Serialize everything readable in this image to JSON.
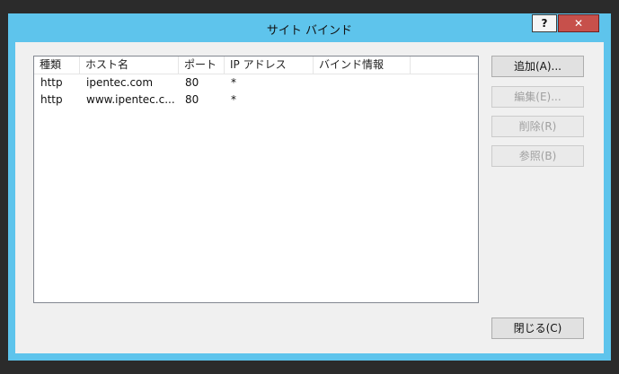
{
  "window": {
    "title": "サイト バインド",
    "help_label": "?",
    "close_label": "✕"
  },
  "list": {
    "columns": [
      "種類",
      "ホスト名",
      "ポート",
      "IP アドレス",
      "バインド情報"
    ],
    "rows": [
      {
        "type": "http",
        "host": "ipentec.com",
        "port": "80",
        "ip": "*",
        "binding": ""
      },
      {
        "type": "http",
        "host": "www.ipentec.c...",
        "port": "80",
        "ip": "*",
        "binding": ""
      }
    ]
  },
  "buttons": {
    "add": "追加(A)...",
    "edit": "編集(E)...",
    "delete": "削除(R)",
    "browse": "参照(B)",
    "close": "閉じる(C)"
  }
}
